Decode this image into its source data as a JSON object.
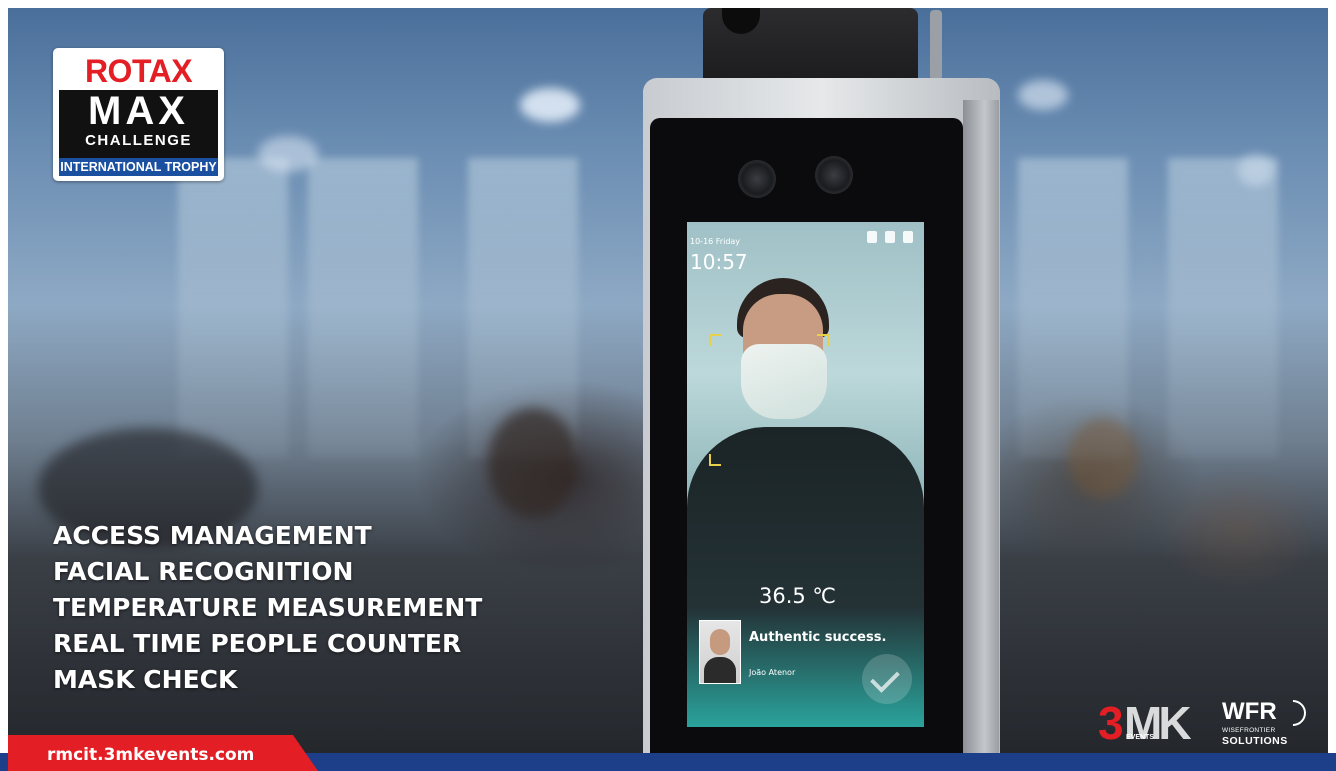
{
  "brand": {
    "rotax": "ROTAX",
    "max": "MAX",
    "challenge": "CHALLENGE",
    "trophy": "INTERNATIONAL TROPHY"
  },
  "features": [
    "ACCESS MANAGEMENT",
    "FACIAL RECOGNITION",
    "TEMPERATURE MEASUREMENT",
    "REAL TIME PEOPLE COUNTER",
    "MASK CHECK"
  ],
  "url": "rmcit.3mkevents.com",
  "device_screen": {
    "date": "10-16 Friday",
    "time": "10:57",
    "temperature": "36.5 ℃",
    "status_message": "Authentic success.",
    "person_name": "João Atenor"
  },
  "partners": {
    "mk_3": "3",
    "mk_letters": "MK",
    "mk_events": "EVENTS",
    "wfr": "WFR",
    "wfr_sub": "WISEFRONTIER",
    "wfr_solutions": "SOLUTIONS"
  },
  "colors": {
    "brand_red": "#e31e24",
    "brand_blue": "#1d3f8a",
    "screen_teal": "#28c6bb"
  }
}
